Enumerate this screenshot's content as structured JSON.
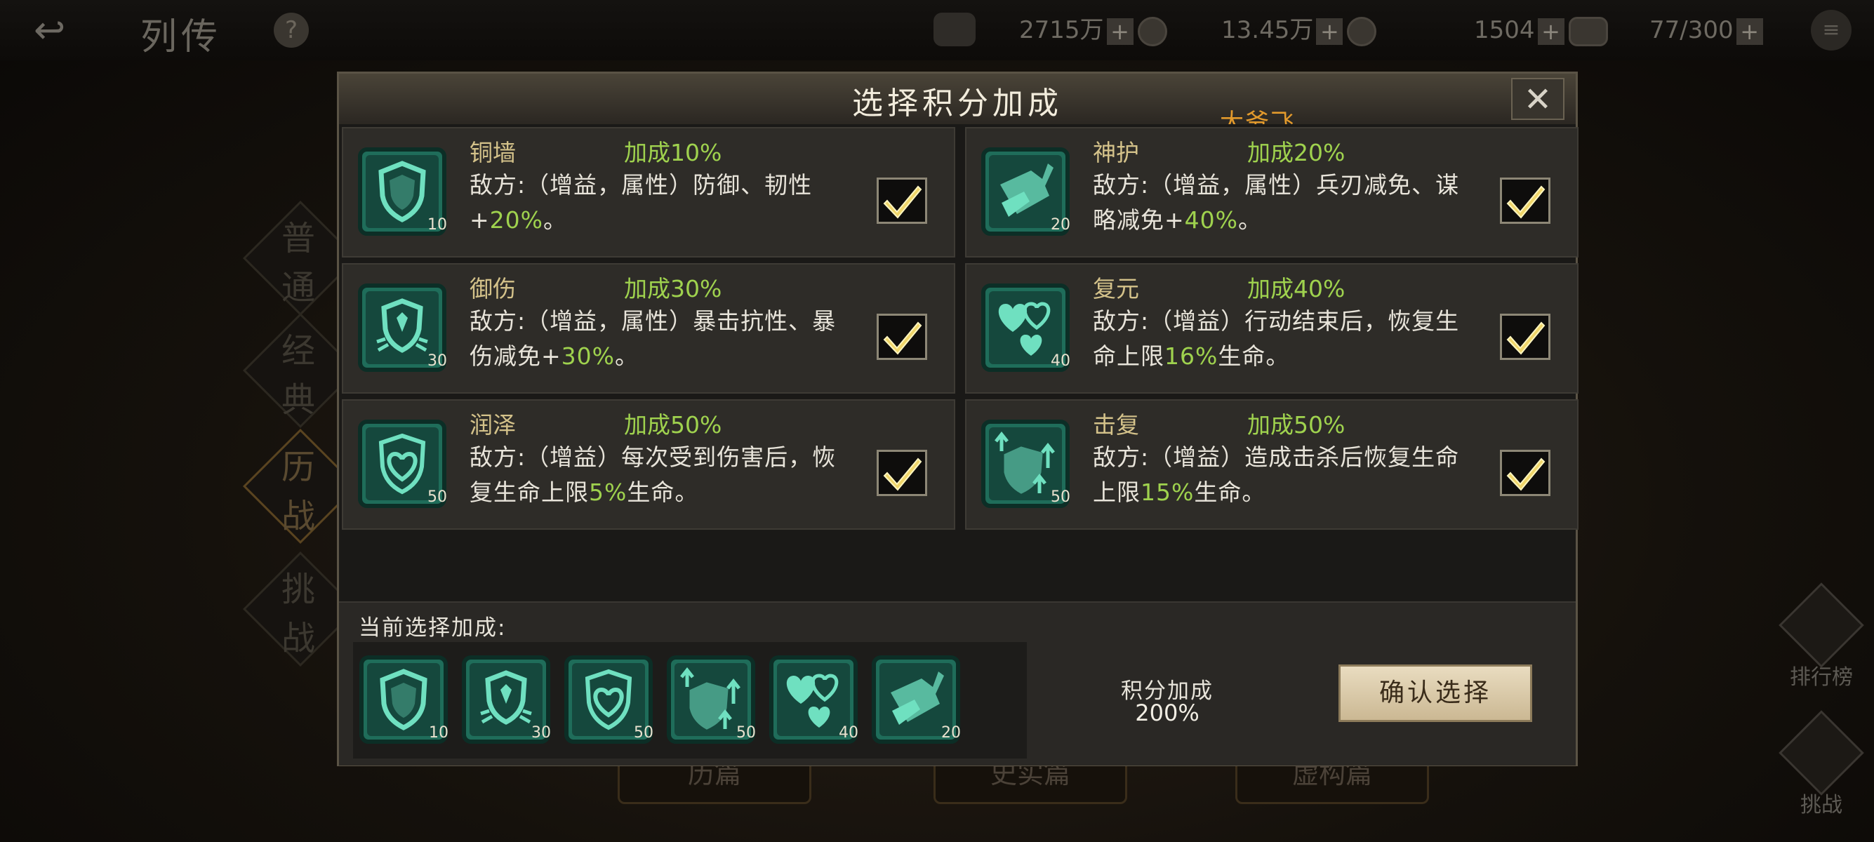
{
  "topbar": {
    "back_icon": "back-arrow-icon",
    "title": "列传",
    "help": "?",
    "resources": [
      {
        "value": "2715万",
        "plus": "+"
      },
      {
        "value": "13.45万",
        "plus": "+"
      },
      {
        "value": "1504",
        "plus": "+"
      },
      {
        "value": "77/300",
        "plus": "+"
      }
    ]
  },
  "side_tabs": [
    "普通",
    "经典",
    "历战",
    "挑战"
  ],
  "right_buttons": [
    "排行榜",
    "挑战"
  ],
  "bottom_tabs": [
    "历篇",
    "史实篇",
    "虚构篇"
  ],
  "dialog": {
    "title": "选择积分加成",
    "close": "✕",
    "player_name": "大爷飞",
    "cards": [
      {
        "name": "铜墙",
        "bonus": "加成10%",
        "desc_pre": "敌方:（增益，属性）防御、韧性+",
        "desc_val": "20%",
        "desc_post": "。",
        "cost": "10",
        "icon": "shield-icon",
        "checked": true
      },
      {
        "name": "神护",
        "bonus": "加成20%",
        "desc_pre": "敌方:（增益，属性）兵刃减免、谋略减免+",
        "desc_val": "40%",
        "desc_post": "。",
        "cost": "20",
        "icon": "broken-blade-icon",
        "checked": true
      },
      {
        "name": "御伤",
        "bonus": "加成30%",
        "desc_pre": "敌方:（增益，属性）暴击抗性、暴伤减免+",
        "desc_val": "30%",
        "desc_post": "。",
        "cost": "30",
        "icon": "winged-shield-icon",
        "checked": true
      },
      {
        "name": "复元",
        "bonus": "加成40%",
        "desc_pre": "敌方:（增益）行动结束后，恢复生命上限",
        "desc_val": "16%",
        "desc_post": "生命。",
        "cost": "40",
        "icon": "hearts-icon",
        "checked": true
      },
      {
        "name": "润泽",
        "bonus": "加成50%",
        "desc_pre": "敌方:（增益）每次受到伤害后，恢复生命上限",
        "desc_val": "5%",
        "desc_post": "生命。",
        "cost": "50",
        "icon": "heart-shield-icon",
        "checked": true
      },
      {
        "name": "击复",
        "bonus": "加成50%",
        "desc_pre": "敌方:（增益）造成击杀后恢复生命上限",
        "desc_val": "15%",
        "desc_post": "生命。",
        "cost": "50",
        "icon": "arrow-shield-icon",
        "checked": true
      }
    ],
    "selected_label": "当前选择加成:",
    "selected": [
      {
        "icon": "shield-icon",
        "cost": "10"
      },
      {
        "icon": "winged-shield-icon",
        "cost": "30"
      },
      {
        "icon": "heart-shield-icon",
        "cost": "50"
      },
      {
        "icon": "arrow-shield-icon",
        "cost": "50"
      },
      {
        "icon": "hearts-icon",
        "cost": "40"
      },
      {
        "icon": "broken-blade-icon",
        "cost": "20"
      }
    ],
    "score_label": "积分加成",
    "score_value": "200%",
    "confirm_label": "确认选择"
  },
  "colors": {
    "accent_green": "#9fd24e",
    "icon_teal": "#6fe0c0",
    "name_gold": "#d4c28a",
    "player_orange": "#e39a2c"
  }
}
